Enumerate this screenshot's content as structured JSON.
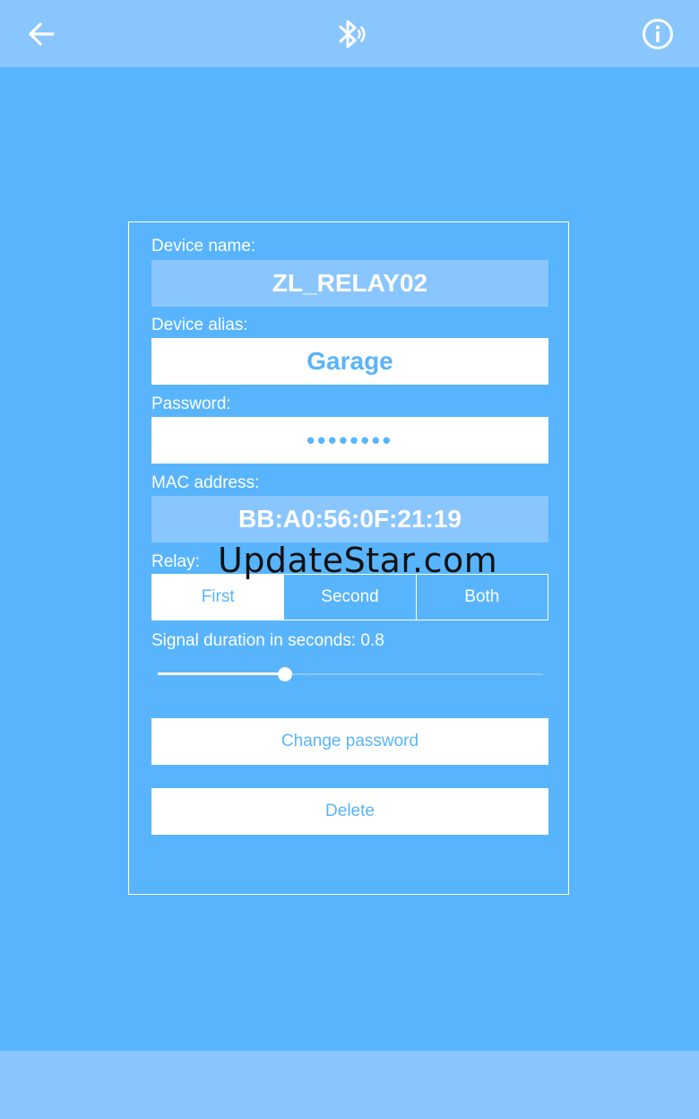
{
  "toolbar": {
    "back_icon": "arrow-left-icon",
    "status_icon": "bluetooth-searching-icon",
    "info_icon": "info-icon"
  },
  "device": {
    "name_label": "Device name:",
    "name_value": "ZL_RELAY02",
    "alias_label": "Device alias:",
    "alias_value": "Garage",
    "password_label": "Password:",
    "password_value": "••••••••",
    "mac_label": "MAC address:",
    "mac_value": "BB:A0:56:0F:21:19",
    "relay_label": "Relay:",
    "relay_options": [
      "First",
      "Second",
      "Both"
    ],
    "relay_selected": "First",
    "signal_label": "Signal duration in seconds: 0.8",
    "signal_fraction": 0.33,
    "change_password_label": "Change password",
    "delete_label": "Delete"
  },
  "watermark": "UpdateStar.com",
  "colors": {
    "background": "#58b4fd",
    "bar": "#8ac6fe",
    "white": "#ffffff"
  }
}
